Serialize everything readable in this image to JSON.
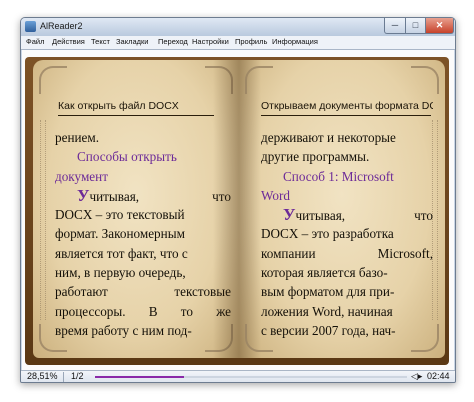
{
  "window": {
    "title": "AlReader2",
    "min_label": "─",
    "max_label": "□",
    "close_label": "✕"
  },
  "menu": [
    "Файл",
    "Действия",
    "Текст",
    "Закладки",
    "Переход",
    "Настройки",
    "Профиль",
    "Информация"
  ],
  "left_page": {
    "header": "Как открыть файл DOCX",
    "lines": [
      "рением.",
      "Способы открыть",
      "документ",
      "читывая, что",
      "DOCX – это текстовый",
      "формат. Закономерным",
      "является тот факт, что с",
      "ним, в первую очередь,",
      "работают текстовые",
      "процессоры. В то же",
      "время работу с ним под-"
    ],
    "dropcap": "У"
  },
  "right_page": {
    "header": "Открываем документы формата DO...",
    "lines": [
      "держивают и некоторые",
      "другие программы.",
      "Способ 1: Microsoft",
      "Word",
      "читывая, что",
      "DOCX – это разработка",
      "компании Microsoft,",
      "которая является базо-",
      "вым форматом для при-",
      "ложения Word, начиная",
      "с версии 2007 года, нач-"
    ],
    "dropcap": "У"
  },
  "status": {
    "percent": "28,51%",
    "pages": "1/2",
    "progress": 0.2851,
    "battery_icon": "battery-icon",
    "time": "02:44"
  },
  "colors": {
    "heading": "#6c2a98",
    "progress": "#8a2aa8"
  }
}
